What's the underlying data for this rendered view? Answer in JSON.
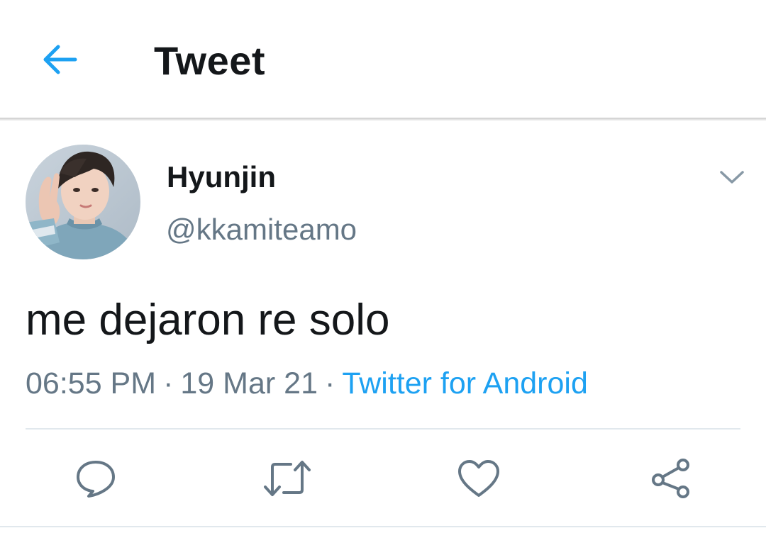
{
  "header": {
    "title": "Tweet",
    "back_icon": "arrow-left-icon"
  },
  "tweet": {
    "author_name": "Hyunjin",
    "author_handle": "@kkamiteamo",
    "text": "me dejaron re solo",
    "time": "06:55 PM",
    "separator": "·",
    "date": "19 Mar 21",
    "source": "Twitter for Android",
    "menu_icon": "chevron-down-icon"
  },
  "actions": [
    {
      "name": "reply",
      "icon": "comment-icon"
    },
    {
      "name": "retweet",
      "icon": "retweet-icon"
    },
    {
      "name": "like",
      "icon": "heart-icon"
    },
    {
      "name": "share",
      "icon": "share-icon"
    }
  ],
  "colors": {
    "accent": "#1da1f2",
    "text": "#14171a",
    "secondary": "#657786",
    "divider": "#e1e8ed"
  }
}
